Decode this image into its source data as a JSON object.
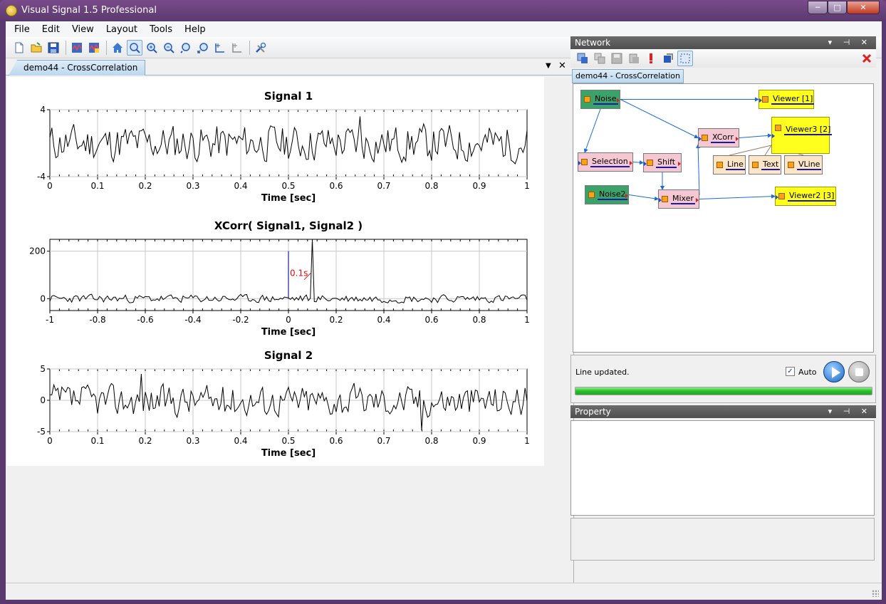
{
  "window": {
    "title": "Visual Signal 1.5 Professional"
  },
  "menu": [
    "File",
    "Edit",
    "View",
    "Layout",
    "Tools",
    "Help"
  ],
  "toolbar": {
    "icons": [
      "new-file-icon",
      "open-folder-icon",
      "save-icon",
      "signal-view-icon",
      "signal-view-2-icon",
      "home-icon",
      "zoom-pan-icon",
      "zoom-in-icon",
      "zoom-out-icon",
      "zoom-fit-icon",
      "zoom-xy-icon",
      "scale-x-icon",
      "scale-y-icon",
      "tools-icon"
    ]
  },
  "document": {
    "tab_label": "demo44 - CrossCorrelation"
  },
  "plots": [
    {
      "title": "Signal 1",
      "xlabel": "Time [sec]",
      "xticks": [
        "0",
        "0.1",
        "0.2",
        "0.3",
        "0.4",
        "0.5",
        "0.6",
        "0.7",
        "0.8",
        "0.9",
        "1"
      ],
      "yticks": [
        "4",
        "-4"
      ]
    },
    {
      "title": "XCorr( Signal1, Signal2 )",
      "xlabel": "Time [sec]",
      "xticks": [
        "-1",
        "-0.8",
        "-0.6",
        "-0.4",
        "-0.2",
        "0",
        "0.2",
        "0.4",
        "0.6",
        "0.8",
        "1"
      ],
      "yticks": [
        "200",
        "0"
      ],
      "annotation": "0.1s"
    },
    {
      "title": "Signal 2",
      "xlabel": "Time [sec]",
      "xticks": [
        "0",
        "0.1",
        "0.2",
        "0.3",
        "0.4",
        "0.5",
        "0.6",
        "0.7",
        "0.8",
        "0.9",
        "1"
      ],
      "yticks": [
        "5",
        "0",
        "-5"
      ]
    }
  ],
  "chart_data": [
    {
      "type": "line",
      "title": "Signal 1",
      "xlabel": "Time [sec]",
      "ylabel": "",
      "xlim": [
        0,
        1
      ],
      "ylim": [
        -4,
        4
      ],
      "grid": true,
      "series": [
        {
          "seed": 11,
          "amp": 1.6,
          "spikes": [
            [
              0.65,
              3.2
            ]
          ]
        }
      ]
    },
    {
      "type": "line",
      "title": "XCorr( Signal1, Signal2 )",
      "xlabel": "Time [sec]",
      "ylabel": "",
      "xlim": [
        -1,
        1
      ],
      "ylim": [
        -50,
        250
      ],
      "grid": true,
      "series": [
        {
          "seed": 23,
          "amp": 12,
          "spikes": [
            [
              0.1,
              250
            ]
          ]
        }
      ],
      "annotation": {
        "text": "0.1s",
        "x": 0.0,
        "color": "#e01010"
      },
      "vline": {
        "x": 0,
        "y": 200,
        "color": "#1a1aa8"
      }
    },
    {
      "type": "line",
      "title": "Signal 2",
      "xlabel": "Time [sec]",
      "ylabel": "",
      "xlim": [
        0,
        1
      ],
      "ylim": [
        -5,
        5
      ],
      "grid": true,
      "series": [
        {
          "seed": 37,
          "amp": 1.8,
          "spikes": [
            [
              0.19,
              4.2
            ],
            [
              0.78,
              -4.8
            ]
          ]
        }
      ]
    }
  ],
  "network": {
    "title": "Network",
    "tab_label": "demo44 - CrossCorrelation",
    "toolbar_icons": [
      "add-node-icon",
      "copy-icon",
      "save-network-icon",
      "paste-icon",
      "warning-icon",
      "refresh-icon",
      "select-region-icon"
    ],
    "close_icon": "close-icon",
    "nodes": [
      {
        "id": "noise",
        "label": "Noise",
        "kind": "green",
        "in": false
      },
      {
        "id": "viewer1",
        "label": "Viewer [1]",
        "kind": "yellow",
        "in": true,
        "out": false
      },
      {
        "id": "xcorr",
        "label": "XCorr",
        "kind": "pink",
        "in": true
      },
      {
        "id": "viewer3",
        "label": "Viewer3 [2]",
        "kind": "yellow",
        "in": true,
        "out": false
      },
      {
        "id": "selection",
        "label": "Selection",
        "kind": "pink",
        "in": true
      },
      {
        "id": "shift",
        "label": "Shift",
        "kind": "pink",
        "in": true
      },
      {
        "id": "line",
        "label": "Line",
        "kind": "peach",
        "in": false
      },
      {
        "id": "text",
        "label": "Text",
        "kind": "peach",
        "in": false
      },
      {
        "id": "vline",
        "label": "VLine",
        "kind": "peach",
        "in": false
      },
      {
        "id": "noise2",
        "label": "Noise2",
        "kind": "green",
        "in": false
      },
      {
        "id": "mixer",
        "label": "Mixer",
        "kind": "pink",
        "in": true
      },
      {
        "id": "viewer2",
        "label": "Viewer2 [3]",
        "kind": "yellow",
        "in": true,
        "out": false
      }
    ],
    "edges": [
      [
        "noise",
        "viewer1"
      ],
      [
        "noise",
        "xcorr"
      ],
      [
        "noise",
        "selection"
      ],
      [
        "selection",
        "shift"
      ],
      [
        "shift",
        "mixer"
      ],
      [
        "noise2",
        "mixer"
      ],
      [
        "mixer",
        "xcorr"
      ],
      [
        "mixer",
        "viewer2"
      ],
      [
        "xcorr",
        "viewer3"
      ],
      [
        "line",
        "viewer3"
      ],
      [
        "text",
        "viewer3"
      ],
      [
        "vline",
        "viewer3"
      ]
    ]
  },
  "status": {
    "message": "Line updated.",
    "auto_label": "Auto",
    "auto_checked": true,
    "progress": 1.0
  },
  "property": {
    "title": "Property"
  },
  "colors": {
    "accent": "#1866c8",
    "progress": "#2bbd2b",
    "xcorr_annotation": "#e01010"
  }
}
